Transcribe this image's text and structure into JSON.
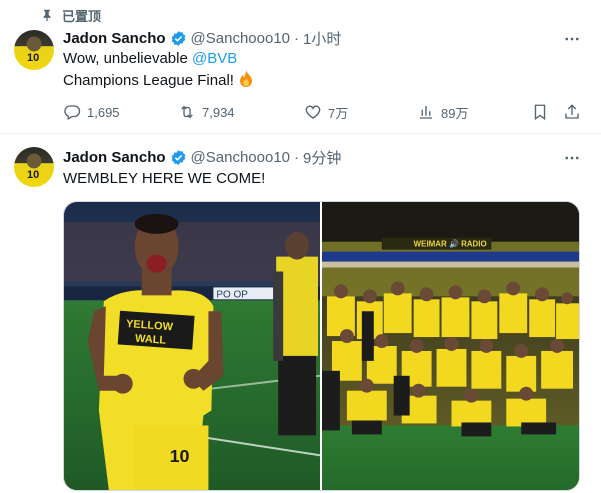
{
  "pinned": {
    "label": "已置顶",
    "icon": "pin-icon"
  },
  "tweets": [
    {
      "author": {
        "name": "Jadon Sancho",
        "handle": "@Sanchooo10",
        "avatar_number": "10"
      },
      "separator": "·",
      "time": "1小时",
      "text": {
        "line1_prefix": "Wow, unbelievable ",
        "mention": "@BVB",
        "line2": "Champions League Final! "
      },
      "stats": {
        "replies": "1,695",
        "retweets": "7,934",
        "likes": "7万",
        "views": "89万"
      }
    },
    {
      "author": {
        "name": "Jadon Sancho",
        "handle": "@Sanchooo10",
        "avatar_number": "10"
      },
      "separator": "·",
      "time": "9分钟",
      "text": "WEMBLEY HERE WE COME!",
      "media": {
        "left_photo": {
          "shirt_text_1": "YELLOW",
          "shirt_text_2": "WALL",
          "number": "10",
          "ad_text": "PO OP"
        },
        "right_photo": {
          "banner_text": "WEIMAR 🔊 RADIO"
        }
      }
    }
  ],
  "colors": {
    "accent": "#1d9bf0",
    "muted": "#536471",
    "bvb_yellow": "#f5e12a"
  }
}
